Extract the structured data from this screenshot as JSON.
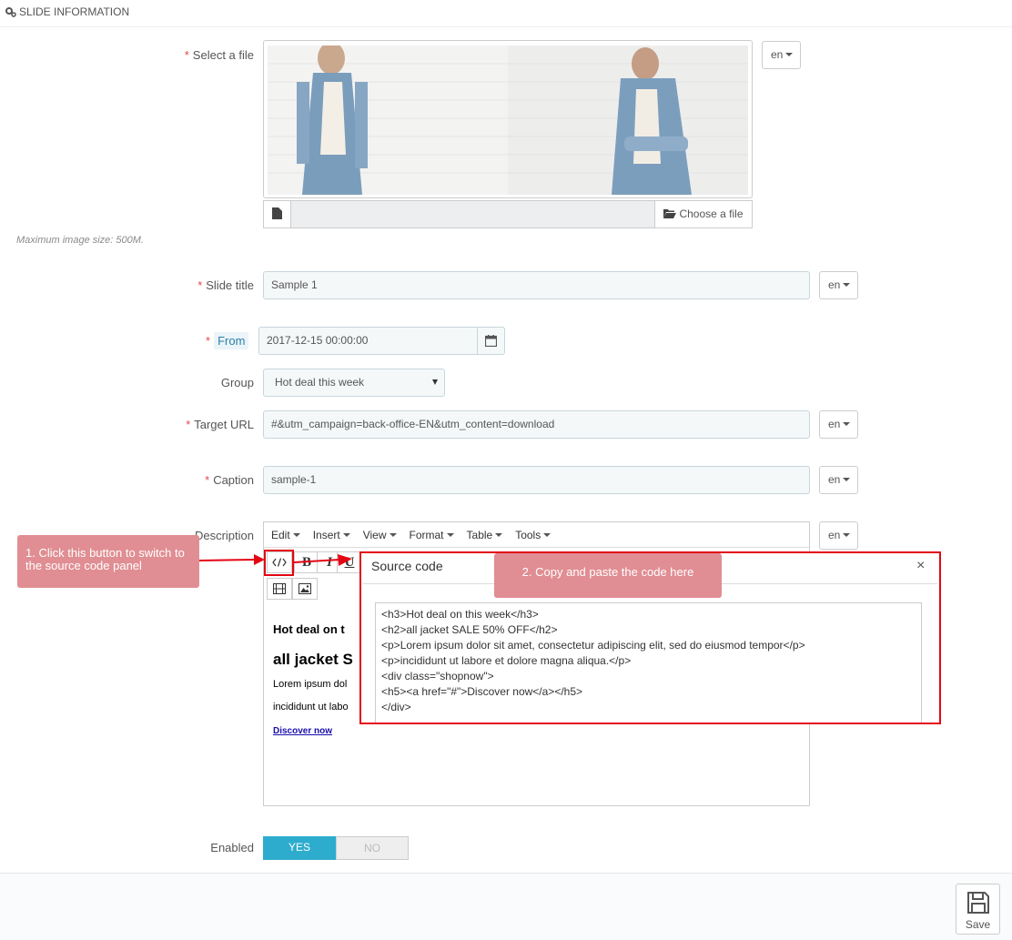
{
  "panel": {
    "title": "SLIDE INFORMATION",
    "icon": "gears-icon"
  },
  "select_file": {
    "label": "Select a file",
    "lang": "en",
    "choose_label": "Choose a file",
    "hint": "Maximum image size: 500M."
  },
  "slide_title": {
    "label": "Slide title",
    "value": "Sample 1",
    "lang": "en"
  },
  "from": {
    "label": "From",
    "value": "2017-12-15 00:00:00"
  },
  "group": {
    "label": "Group",
    "value": "Hot deal this week"
  },
  "target_url": {
    "label": "Target URL",
    "value": "#&utm_campaign=back-office-EN&utm_content=download",
    "lang": "en"
  },
  "caption": {
    "label": "Caption",
    "value": "sample-1",
    "lang": "en"
  },
  "description": {
    "label": "Description",
    "lang": "en",
    "menu": [
      "Edit",
      "Insert",
      "View",
      "Format",
      "Table",
      "Tools"
    ],
    "bold": "B",
    "italic": "I",
    "underline": "U",
    "preview": {
      "h3": "Hot deal on t",
      "h2": "all jacket S",
      "p1": "Lorem ipsum dol",
      "p2": "incididunt ut labo",
      "link": "Discover now"
    }
  },
  "source_dialog": {
    "title": "Source code",
    "close": "×",
    "lines": [
      "<h3>Hot deal on this week</h3>",
      "<h2>all jacket SALE 50% OFF</h2>",
      "<p>Lorem ipsum dolor sit amet, consectetur adipiscing elit, sed do eiusmod tempor</p>",
      "<p>incididunt ut labore et dolore magna aliqua.</p>",
      "<div class=\"shopnow\">",
      "<h5><a href=\"#\">Discover now</a></h5>",
      "</div>"
    ]
  },
  "callouts": {
    "step1": "1. Click this button to switch to the source code panel",
    "step2": "2. Copy and paste the code here"
  },
  "enabled": {
    "label": "Enabled",
    "yes": "YES",
    "no": "NO",
    "value": "YES"
  },
  "footer": {
    "save_label": "Save"
  },
  "colors": {
    "accent": "#2eacce",
    "required": "#e3494b",
    "annotation": "#e30613",
    "callout": "#e08e93"
  }
}
